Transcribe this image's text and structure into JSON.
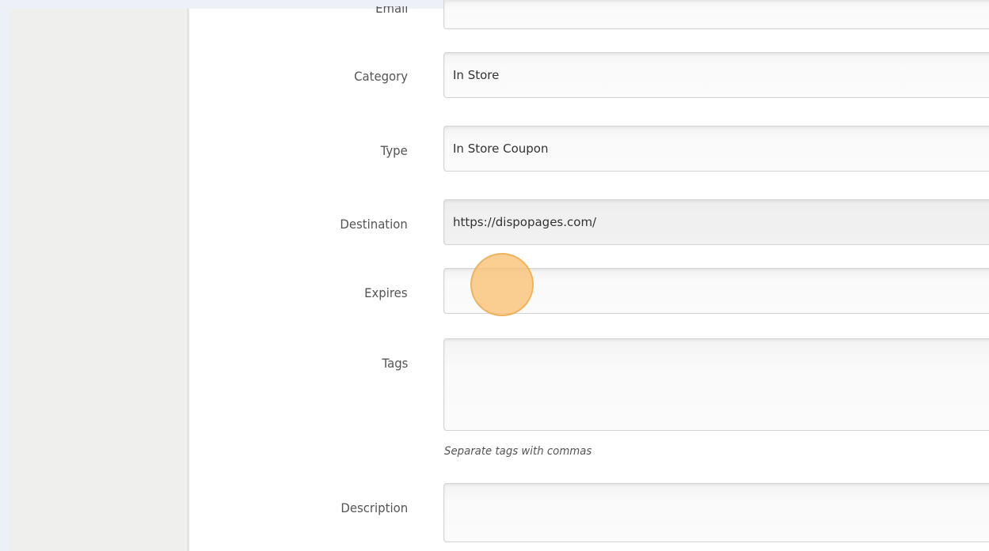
{
  "form": {
    "email": {
      "label": "Email",
      "value": ""
    },
    "category": {
      "label": "Category",
      "value": "In Store"
    },
    "type": {
      "label": "Type",
      "value": "In Store Coupon"
    },
    "destination": {
      "label": "Destination",
      "value": "https://dispopages.com/"
    },
    "expires": {
      "label": "Expires",
      "value": ""
    },
    "tags": {
      "label": "Tags",
      "value": "",
      "help": "Separate tags with commas"
    },
    "description": {
      "label": "Description",
      "value": ""
    }
  },
  "colors": {
    "click_marker": "#f8bd6c",
    "page_background": "#eef0f7",
    "sidebar": "#eff0ee"
  }
}
